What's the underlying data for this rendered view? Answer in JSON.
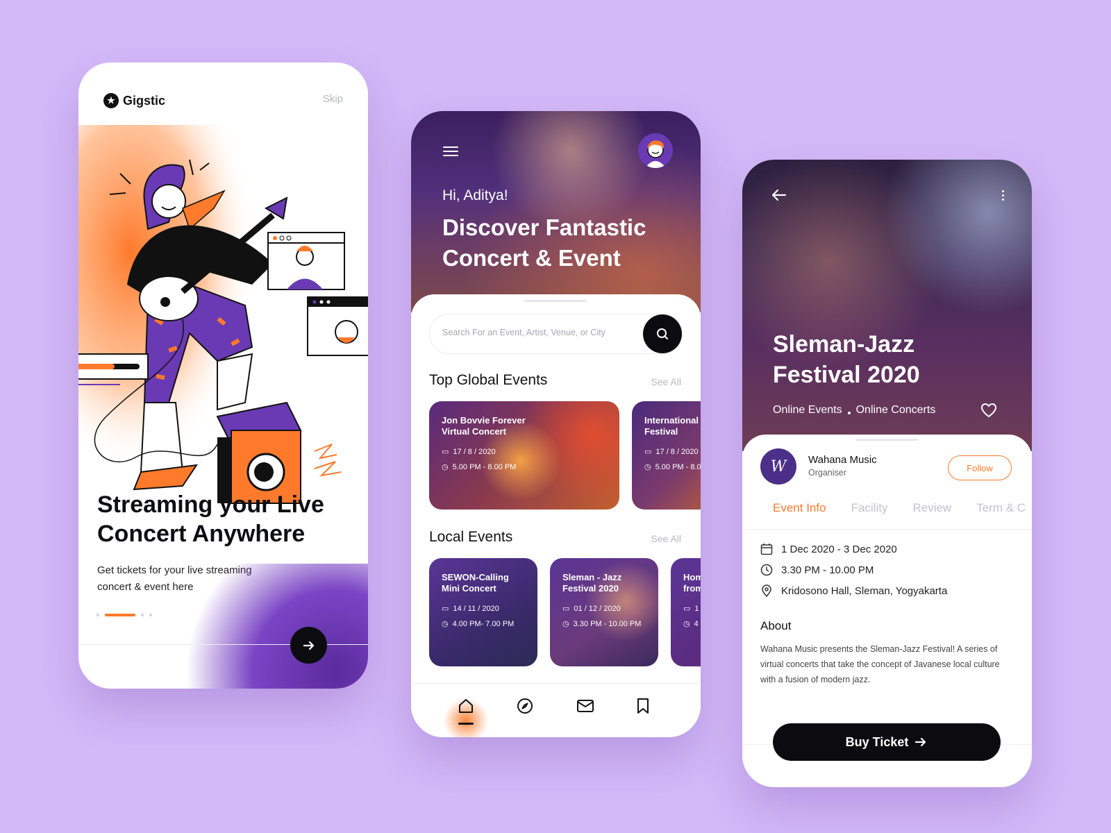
{
  "colors": {
    "background": "#d3b9f7",
    "accent": "#ff7a2b",
    "purple": "#5b2a9d",
    "dark": "#0b0b10"
  },
  "onboarding": {
    "brand": "Gigstic",
    "skip": "Skip",
    "title": "Streaming your Live Concert Anywhere",
    "subtitle": "Get tickets for your live streaming concert & event here",
    "next_icon": "arrow-right-icon",
    "pager": {
      "pages": 4,
      "active": 1
    }
  },
  "home": {
    "greeting": "Hi, Aditya!",
    "headline": "Discover Fantastic Concert & Event",
    "search": {
      "placeholder": "Search For an Event, Artist, Venue, or City"
    },
    "top_global": {
      "title": "Top Global Events",
      "see_all": "See All",
      "cards": [
        {
          "title": "Jon Bovvie Forever Virtual Concert",
          "date": "17 / 8 / 2020",
          "time": "5.00 PM - 8.00 PM"
        },
        {
          "title": "International Festival",
          "date": "17 / 8 / 2020",
          "time": "5.00 PM - 8.0"
        }
      ]
    },
    "local": {
      "title": "Local Events",
      "see_all": "See All",
      "cards": [
        {
          "title": "SEWON-Calling Mini Concert",
          "date": "14 / 11 / 2020",
          "time": "4.00 PM- 7.00 PM"
        },
        {
          "title": "Sleman - Jazz Festival 2020",
          "date": "01 / 12 / 2020",
          "time": "3.30 PM - 10.00 PM"
        },
        {
          "title": "Hom from",
          "date": "1",
          "time": "4"
        }
      ]
    },
    "nav": [
      "home-icon",
      "compass-icon",
      "mail-icon",
      "bookmark-icon"
    ]
  },
  "detail": {
    "title": "Sleman-Jazz Festival 2020",
    "tag1": "Online Events",
    "tag2": "Online Concerts",
    "organiser": {
      "name": "Wahana Music",
      "role": "Organiser",
      "follow": "Follow"
    },
    "tabs": [
      "Event Info",
      "Facility",
      "Review",
      "Term & C"
    ],
    "date": "1 Dec 2020 - 3 Dec 2020",
    "time": "3.30 PM - 10.00 PM",
    "location": "Kridosono Hall, Sleman, Yogyakarta",
    "about_title": "About",
    "about_text": "Wahana Music presents the Sleman-Jazz Festival! A series of virtual concerts that take the concept of Javanese local culture with a fusion of modern jazz.",
    "buy": "Buy Ticket"
  }
}
